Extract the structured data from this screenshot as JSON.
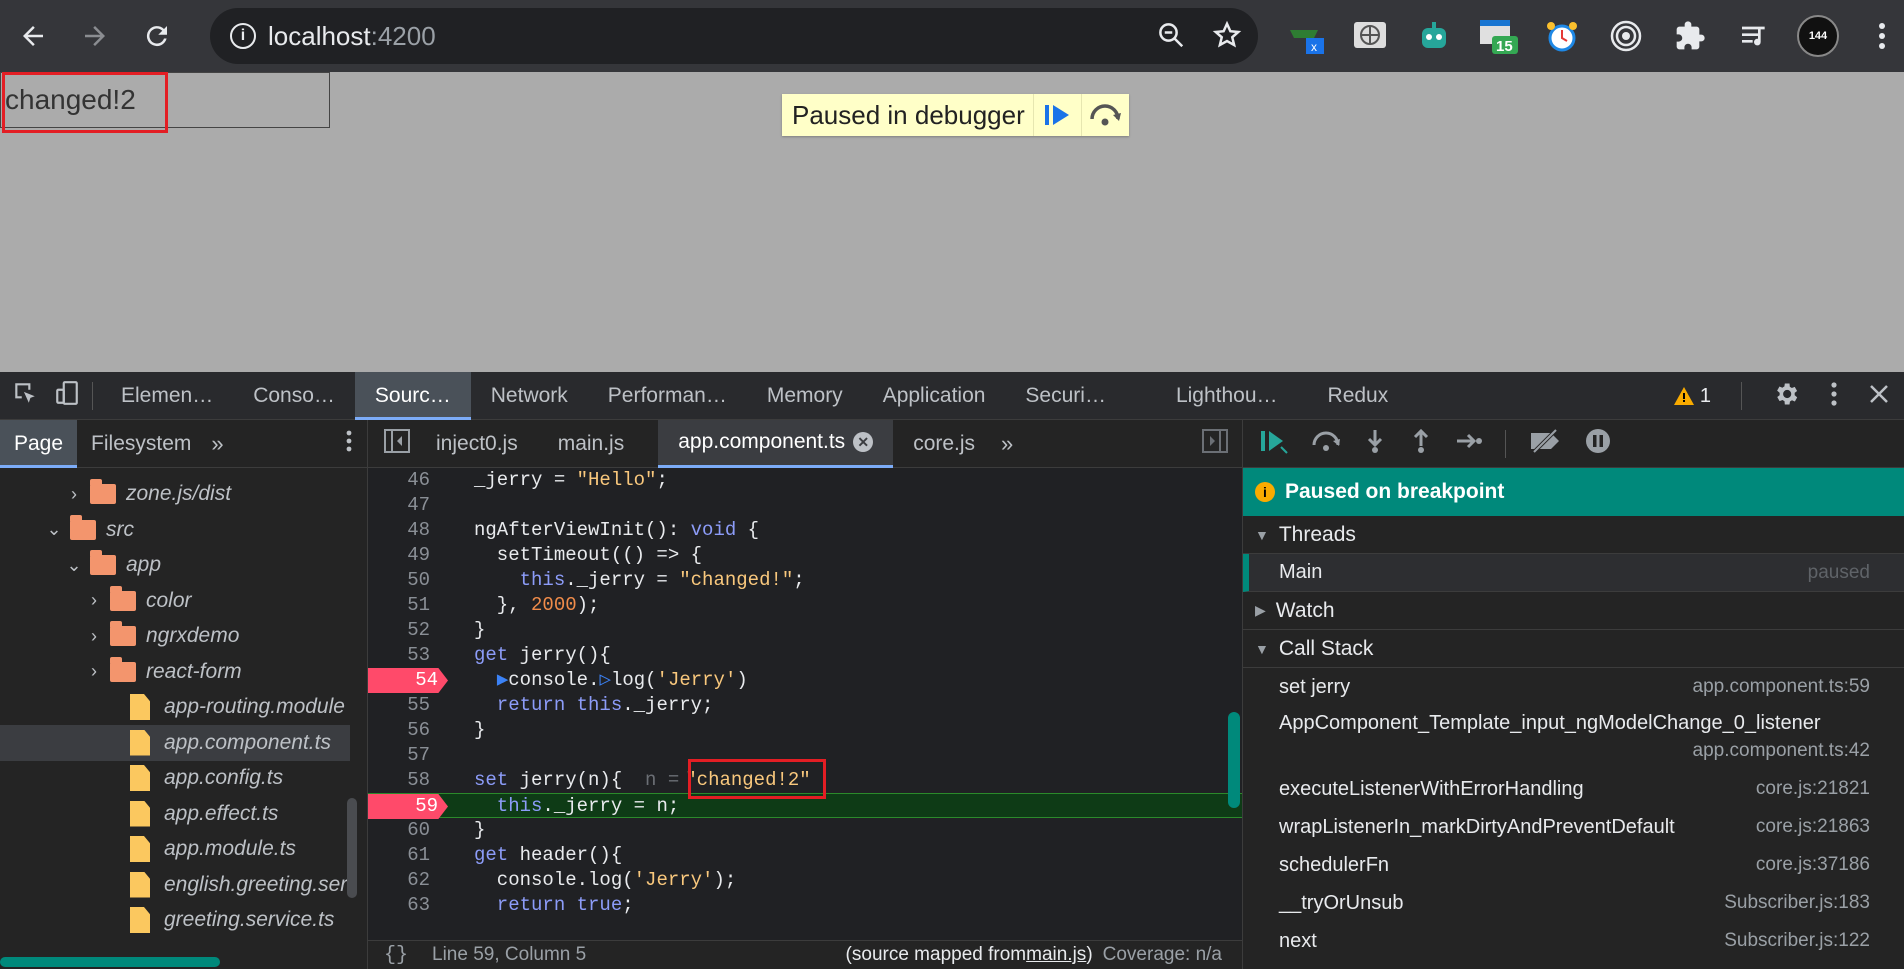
{
  "browser": {
    "url_host": "localhost",
    "url_port": ":4200",
    "badge_15": "15",
    "avatar_text": "144"
  },
  "page": {
    "input_value": "changed!2",
    "paused_text": "Paused in debugger"
  },
  "devtools": {
    "tabs": [
      "Elemen…",
      "Conso…",
      "Sourc…",
      "Network",
      "Performan…",
      "Memory",
      "Application",
      "Securi…",
      "Lighthou…",
      "Redux"
    ],
    "warning_count": "1",
    "nav_tabs": [
      "Page",
      "Filesystem"
    ],
    "tree": [
      {
        "label": "zone.js/dist",
        "kind": "folder",
        "chev": "›"
      },
      {
        "label": "src",
        "kind": "folder",
        "chev": "⌄"
      },
      {
        "label": "app",
        "kind": "folder",
        "chev": "⌄"
      },
      {
        "label": "color",
        "kind": "folder",
        "chev": "›"
      },
      {
        "label": "ngrxdemo",
        "kind": "folder",
        "chev": "›"
      },
      {
        "label": "react-form",
        "kind": "folder",
        "chev": "›"
      },
      {
        "label": "app-routing.module",
        "kind": "file",
        "chev": ""
      },
      {
        "label": "app.component.ts",
        "kind": "file",
        "chev": ""
      },
      {
        "label": "app.config.ts",
        "kind": "file",
        "chev": ""
      },
      {
        "label": "app.effect.ts",
        "kind": "file",
        "chev": ""
      },
      {
        "label": "app.module.ts",
        "kind": "file",
        "chev": ""
      },
      {
        "label": "english.greeting.ser",
        "kind": "file",
        "chev": ""
      },
      {
        "label": "greeting.service.ts",
        "kind": "file",
        "chev": ""
      }
    ],
    "editor_tabs": [
      "inject0.js",
      "main.js",
      "app.component.ts",
      "core.js"
    ],
    "lines": [
      "46",
      "47",
      "48",
      "49",
      "50",
      "51",
      "52",
      "53",
      "54",
      "55",
      "56",
      "57",
      "58",
      "59",
      "60",
      "61",
      "62",
      "63"
    ],
    "inline_value_n": "n =",
    "inline_value": "\"changed!2\"",
    "status": {
      "position": "Line 59, Column 5",
      "mapped_prefix": "(source mapped from ",
      "mapped_file": "main.js",
      "mapped_suffix": ")",
      "coverage": "Coverage: n/a"
    },
    "debugger": {
      "paused_label": "Paused on breakpoint",
      "threads": "Threads",
      "main_thread": "Main",
      "main_state": "paused",
      "watch": "Watch",
      "call_stack": "Call Stack",
      "frames": [
        {
          "fn": "set jerry",
          "loc": "app.component.ts:59"
        },
        {
          "fn": "AppComponent_Template_input_ngModelChange_0_listener",
          "loc": "app.component.ts:42"
        },
        {
          "fn": "executeListenerWithErrorHandling",
          "loc": "core.js:21821"
        },
        {
          "fn": "wrapListenerIn_markDirtyAndPreventDefault",
          "loc": "core.js:21863"
        },
        {
          "fn": "schedulerFn",
          "loc": "core.js:37186"
        },
        {
          "fn": "__tryOrUnsub",
          "loc": "Subscriber.js:183"
        },
        {
          "fn": "next",
          "loc": "Subscriber.js:122"
        }
      ]
    }
  },
  "colors": {
    "breakpoint": "#ff4a6a",
    "paused_bar": "#00897b",
    "highlight": "#0e3b16"
  }
}
